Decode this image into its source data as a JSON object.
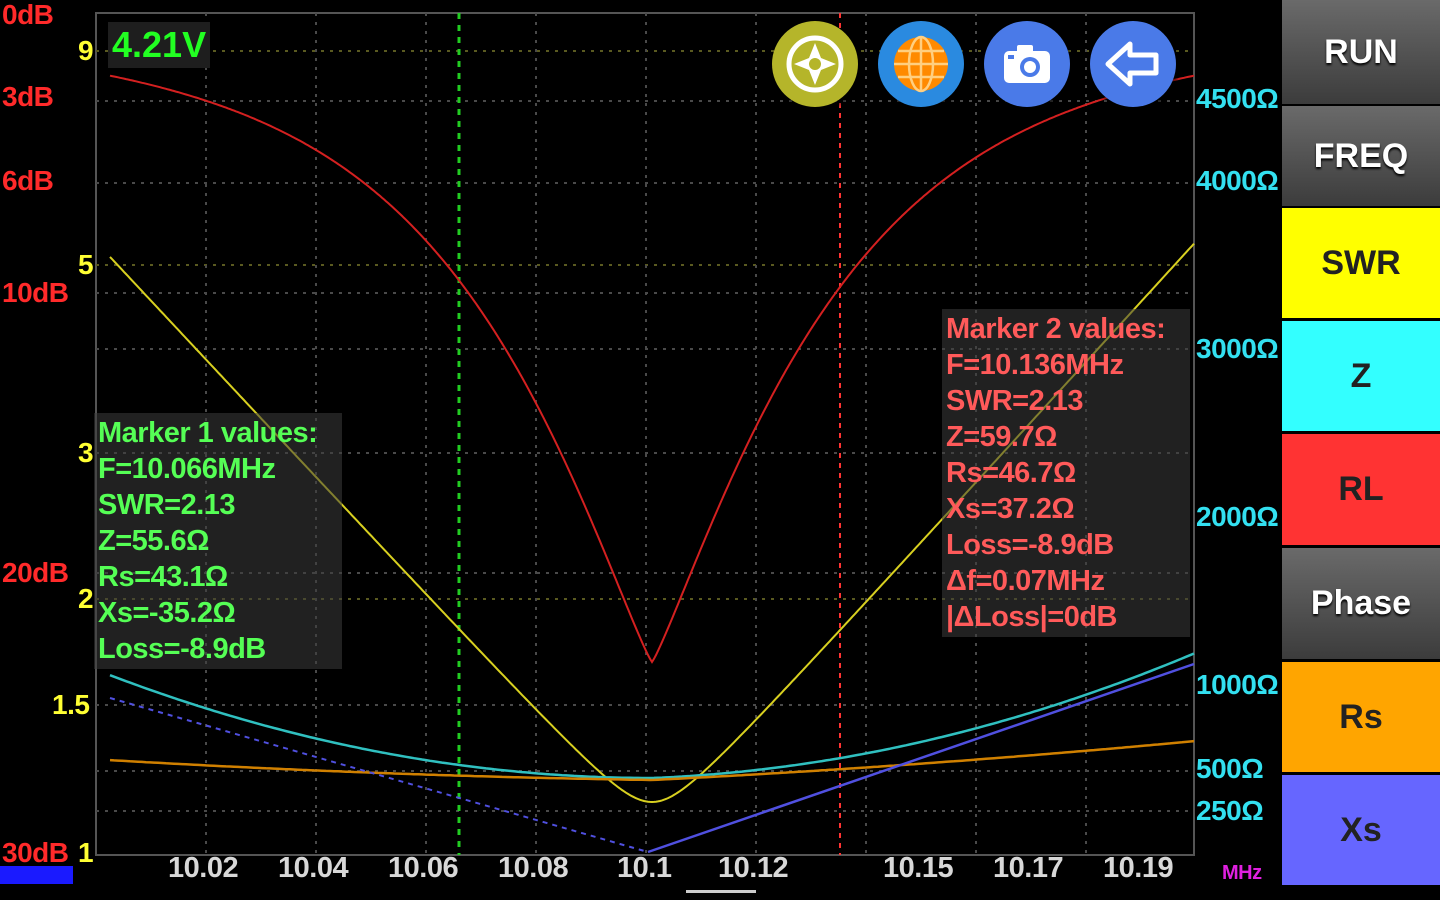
{
  "voltage": "4.21V",
  "rl_axis": [
    "0dB",
    "3dB",
    "6dB",
    "10dB",
    "20dB",
    "30dB"
  ],
  "swr_axis": [
    "9",
    "5",
    "3",
    "2",
    "1.5",
    "1"
  ],
  "ohm_axis": [
    "4500Ω",
    "4000Ω",
    "3000Ω",
    "2000Ω",
    "1000Ω",
    "500Ω",
    "250Ω"
  ],
  "x_axis": [
    "10.02",
    "10.04",
    "10.06",
    "10.08",
    "10.1",
    "10.12",
    "10.15",
    "10.17",
    "10.19"
  ],
  "x_unit": "MHz",
  "marker1": {
    "title": "Marker 1 values:",
    "f": "F=10.066MHz",
    "swr": "SWR=2.13",
    "z": "Z=55.6Ω",
    "rs": "Rs=43.1Ω",
    "xs": "Xs=-35.2Ω",
    "loss": "Loss=-8.9dB"
  },
  "marker2": {
    "title": "Marker 2 values:",
    "f": "F=10.136MHz",
    "swr": "SWR=2.13",
    "z": "Z=59.7Ω",
    "rs": "Rs=46.7Ω",
    "xs": "Xs=37.2Ω",
    "loss": "Loss=-8.9dB",
    "df": "Δf=0.07MHz",
    "dloss": "|ΔLoss|=0dB"
  },
  "buttons": {
    "run": "RUN",
    "freq": "FREQ",
    "swr": "SWR",
    "z": "Z",
    "rl": "RL",
    "phase": "Phase",
    "rs": "Rs",
    "xs": "Xs"
  },
  "round_buttons": [
    "target-icon",
    "globe-icon",
    "camera-icon",
    "back-arrow-icon"
  ],
  "colors": {
    "rl_curve": "#d42020",
    "swr_curve": "#d8d020",
    "z_curve": "#30c0c0",
    "rs_curve": "#d08000",
    "xs_curve": "#5050e0",
    "marker1": "#22cc22",
    "marker2": "#ff3333"
  }
}
